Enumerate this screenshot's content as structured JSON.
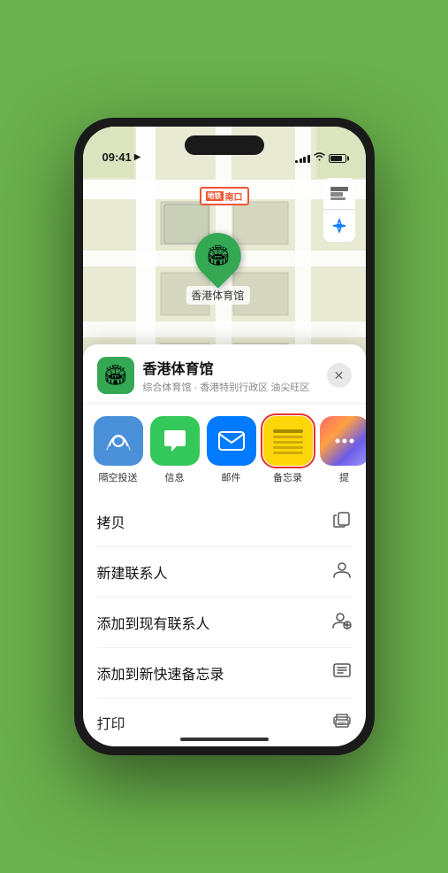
{
  "status_bar": {
    "time": "09:41",
    "navigation_arrow": "▲"
  },
  "map": {
    "metro_label": "南口",
    "metro_badge": "地铁",
    "map_icon": "🗺",
    "location_icon": "⬆",
    "pin_emoji": "🏟",
    "pin_label": "香港体育馆"
  },
  "sheet": {
    "venue_emoji": "🏟",
    "venue_name": "香港体育馆",
    "venue_sub": "综合体育馆 · 香港特别行政区 油尖旺区",
    "close_icon": "✕"
  },
  "share_items": [
    {
      "id": "airdrop",
      "label": "隔空投送",
      "emoji": "📶"
    },
    {
      "id": "messages",
      "label": "信息",
      "emoji": "💬"
    },
    {
      "id": "mail",
      "label": "邮件",
      "emoji": "✉️"
    },
    {
      "id": "notes",
      "label": "备忘录",
      "selected": true
    },
    {
      "id": "more",
      "label": "提"
    }
  ],
  "actions": [
    {
      "id": "copy",
      "label": "拷贝",
      "icon": "⎘"
    },
    {
      "id": "new-contact",
      "label": "新建联系人",
      "icon": "👤"
    },
    {
      "id": "add-existing",
      "label": "添加到现有联系人",
      "icon": "👤"
    },
    {
      "id": "quick-note",
      "label": "添加到新快速备忘录",
      "icon": "🖼"
    },
    {
      "id": "print",
      "label": "打印",
      "icon": "🖨"
    }
  ]
}
